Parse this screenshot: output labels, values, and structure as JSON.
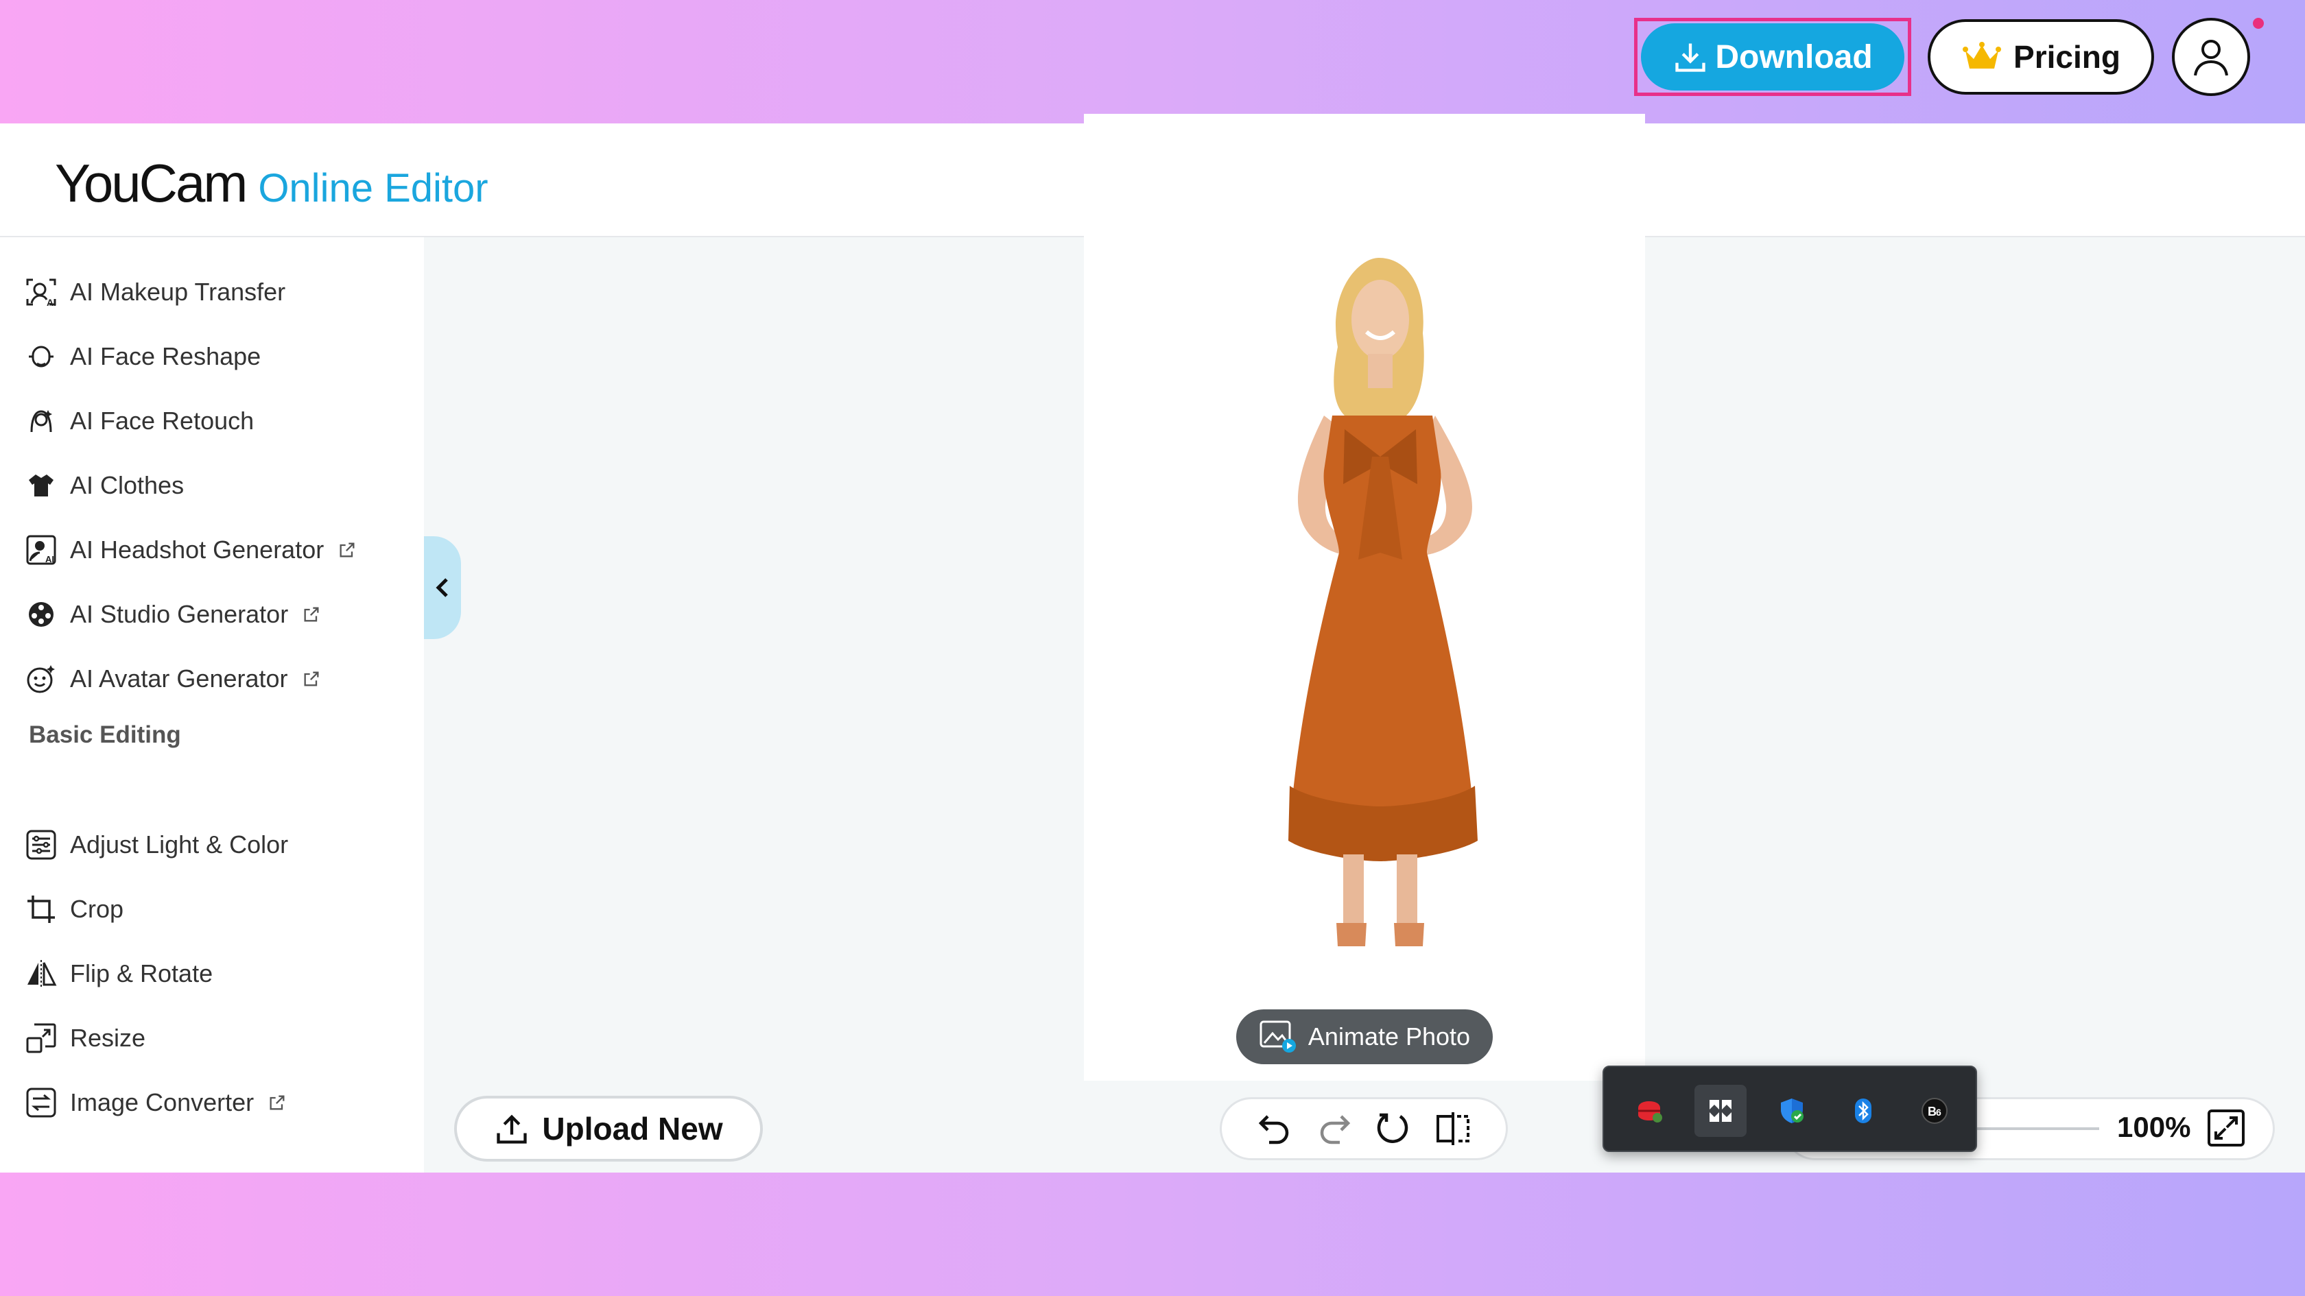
{
  "header": {
    "logo_brand": "YouCam",
    "logo_sub": "Online Editor",
    "download_label": "Download",
    "pricing_label": "Pricing"
  },
  "sidebar": {
    "ai_items": [
      {
        "label": "AI Makeup Transfer",
        "icon": "makeup-transfer-icon",
        "external": false
      },
      {
        "label": "AI Face Reshape",
        "icon": "face-reshape-icon",
        "external": false
      },
      {
        "label": "AI Face Retouch",
        "icon": "face-retouch-icon",
        "external": false
      },
      {
        "label": "AI Clothes",
        "icon": "clothes-icon",
        "external": false
      },
      {
        "label": "AI Headshot Generator",
        "icon": "headshot-icon",
        "external": true
      },
      {
        "label": "AI Studio Generator",
        "icon": "studio-icon",
        "external": true
      },
      {
        "label": "AI Avatar Generator",
        "icon": "avatar-generator-icon",
        "external": true
      }
    ],
    "section_title": "Basic Editing",
    "basic_items": [
      {
        "label": "Adjust Light & Color",
        "icon": "adjust-icon",
        "external": false
      },
      {
        "label": "Crop",
        "icon": "crop-icon",
        "external": false
      },
      {
        "label": "Flip & Rotate",
        "icon": "flip-rotate-icon",
        "external": false
      },
      {
        "label": "Resize",
        "icon": "resize-icon",
        "external": false
      },
      {
        "label": "Image Converter",
        "icon": "image-converter-icon",
        "external": true
      }
    ]
  },
  "canvas": {
    "animate_label": "Animate Photo",
    "upload_label": "Upload New",
    "zoom_value": "100%"
  },
  "tray": {
    "icons": [
      "red-app-icon",
      "snap-app-icon",
      "security-shield-icon",
      "bluetooth-icon",
      "beats-icon"
    ]
  },
  "colors": {
    "accent": "#15a7e0",
    "highlight_outline": "#e8308a",
    "dress": "#c8621f"
  }
}
